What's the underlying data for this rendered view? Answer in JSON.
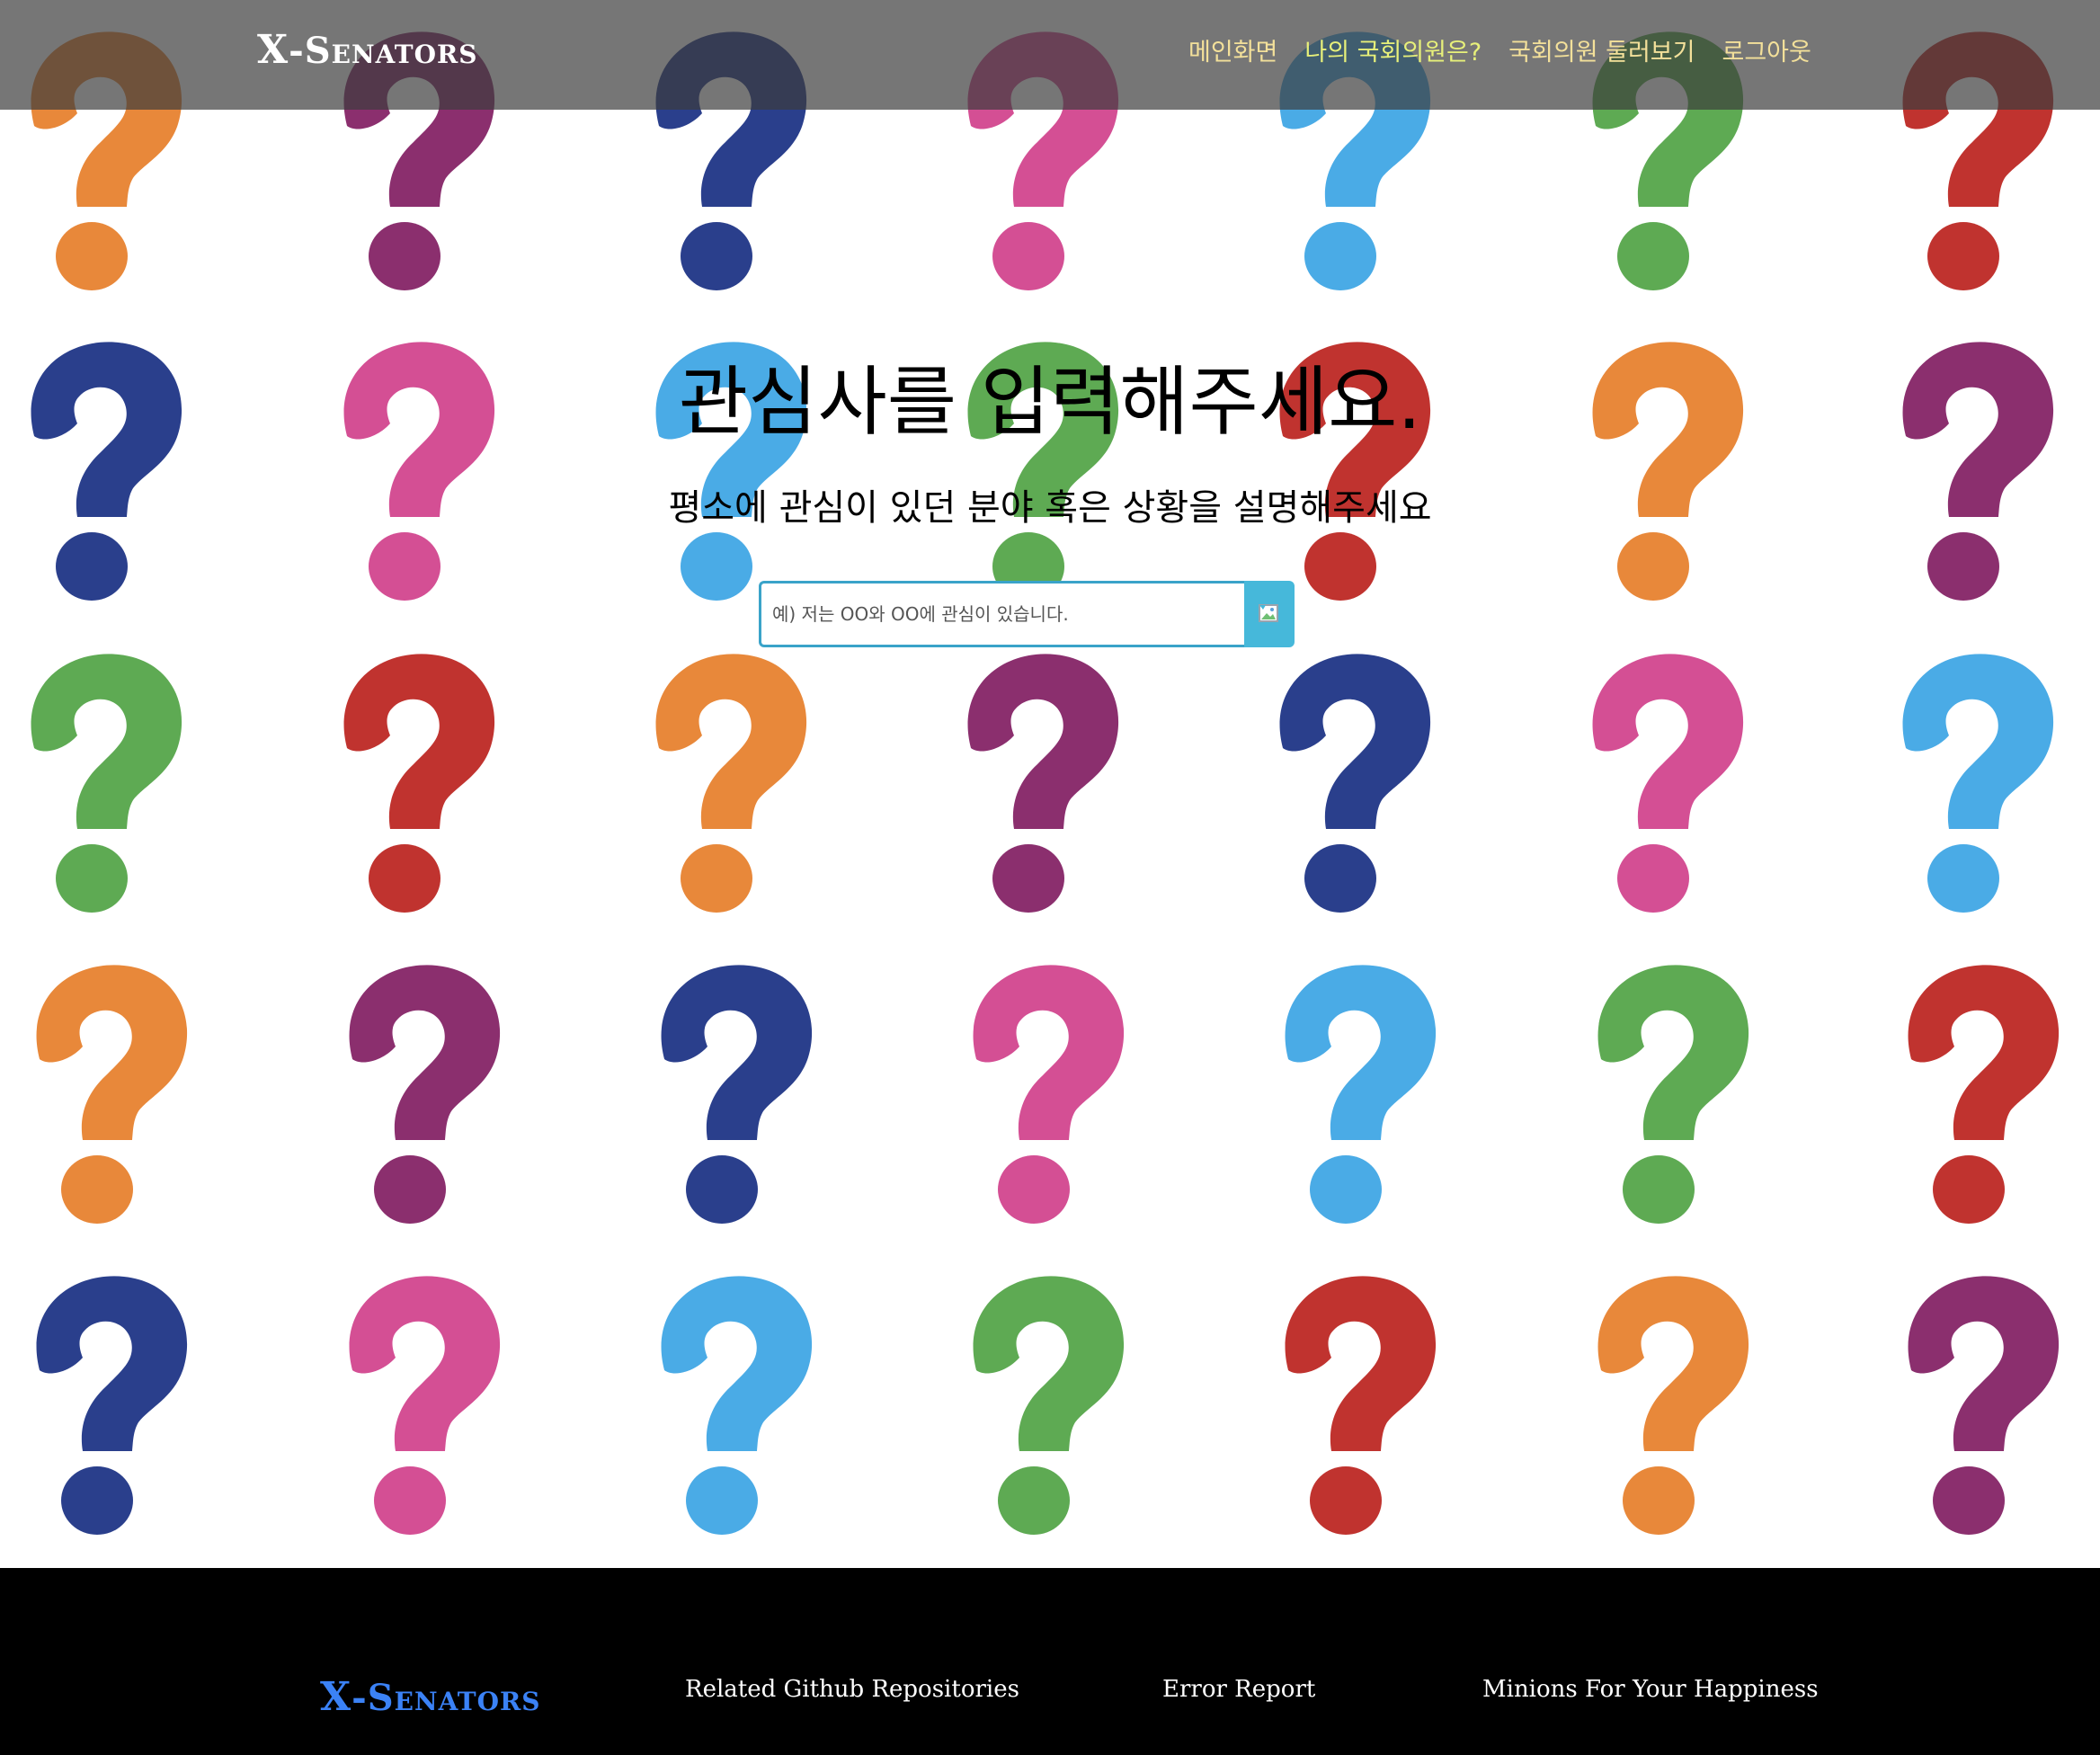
{
  "colors": {
    "orange": "#e8883a",
    "purple": "#8b2f6e",
    "navy": "#2a3f8c",
    "pink": "#d44f94",
    "sky": "#4aabe6",
    "green": "#5eaa53",
    "red": "#c0332f",
    "navbar_link": "#f3e09a",
    "navbar_link_active": "#e7f07a",
    "footer_brand": "#3b82f6",
    "search_border": "#3aa3c9",
    "search_button": "#46b8da"
  },
  "background": {
    "pattern_icon": "question-mark-icon",
    "rows": [
      [
        "orange",
        "purple",
        "navy",
        "pink",
        "sky",
        "green",
        "red"
      ],
      [
        "navy",
        "pink",
        "sky",
        "green",
        "red",
        "orange",
        "purple"
      ],
      [
        "green",
        "red",
        "orange",
        "purple",
        "navy",
        "pink",
        "sky"
      ],
      [
        "orange",
        "purple",
        "navy",
        "pink",
        "sky",
        "green",
        "red"
      ],
      [
        "navy",
        "pink",
        "sky",
        "green",
        "red",
        "orange",
        "purple"
      ]
    ]
  },
  "navbar": {
    "brand": {
      "first": "X",
      "rest": "-Senators"
    },
    "links": [
      {
        "label": "메인화면",
        "active": false
      },
      {
        "label": "나의 국회의원은?",
        "active": true
      },
      {
        "label": "국회의원 둘러보기",
        "active": false
      },
      {
        "label": "로그아웃",
        "active": false
      }
    ]
  },
  "hero": {
    "title": "관심사를 입력해주세요.",
    "subtitle": "평소에 관심이 있던 분야 혹은 상황을 설명해주세요"
  },
  "search": {
    "placeholder": "예) 저는 OO와 OO에 관심이 있습니다.",
    "value": "",
    "button_icon": "broken-image-icon"
  },
  "footer": {
    "brand": {
      "first": "X",
      "rest": "-Senators"
    },
    "links": [
      "Related Github Repositories",
      "Error Report",
      "Minions For Your Happiness"
    ]
  }
}
